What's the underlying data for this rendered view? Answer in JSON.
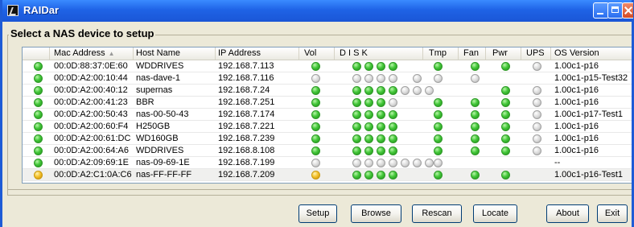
{
  "window": {
    "title": "RAIDar"
  },
  "group_title": "Select a NAS device to setup",
  "columns": [
    "Mac Address",
    "Host Name",
    "IP Address",
    "Vol",
    "D  I  S  K",
    "Tmp",
    "Fan",
    "Pwr",
    "UPS",
    "OS Version"
  ],
  "sort_indicator": "▲",
  "status_colors": {
    "green": "#44c83a",
    "gray": "#c8c8c8",
    "yellow": "#f5c330"
  },
  "rows": [
    {
      "status": "green",
      "mac": "00:0D:88:37:0E:60",
      "host": "WDDRIVES",
      "ip": "192.168.7.113",
      "vol": "green",
      "disks": [
        "green",
        "green",
        "green",
        "green"
      ],
      "tmp": "green",
      "fan": "green",
      "pwr": "green",
      "ups": "gray",
      "os": "1.00c1-p16"
    },
    {
      "status": "green",
      "mac": "00:0D:A2:00:10:44",
      "host": "nas-dave-1",
      "ip": "192.168.7.116",
      "vol": "gray",
      "disks": [
        "gray",
        "gray",
        "gray",
        "gray",
        "",
        "gray"
      ],
      "tmp": "gray",
      "fan": "gray",
      "pwr": "",
      "ups": "",
      "os": "1.00c1-p15-Test32"
    },
    {
      "status": "green",
      "mac": "00:0D:A2:00:40:12",
      "host": "supernas",
      "ip": "192.168.7.24",
      "vol": "green",
      "disks": [
        "green",
        "green",
        "green",
        "green",
        "gray",
        "gray",
        "gray"
      ],
      "tmp": "",
      "fan": "",
      "pwr": "green",
      "ups": "gray",
      "os": "1.00c1-p16"
    },
    {
      "status": "green",
      "mac": "00:0D:A2:00:41:23",
      "host": "BBR",
      "ip": "192.168.7.251",
      "vol": "green",
      "disks": [
        "green",
        "green",
        "green",
        "gray"
      ],
      "tmp": "green",
      "fan": "green",
      "pwr": "green",
      "ups": "gray",
      "os": "1.00c1-p16"
    },
    {
      "status": "green",
      "mac": "00:0D:A2:00:50:43",
      "host": "nas-00-50-43",
      "ip": "192.168.7.174",
      "vol": "green",
      "disks": [
        "green",
        "green",
        "green",
        "green"
      ],
      "tmp": "green",
      "fan": "green",
      "pwr": "green",
      "ups": "gray",
      "os": "1.00c1-p17-Test1"
    },
    {
      "status": "green",
      "mac": "00:0D:A2:00:60:F4",
      "host": "H250GB",
      "ip": "192.168.7.221",
      "vol": "green",
      "disks": [
        "green",
        "green",
        "green",
        "green"
      ],
      "tmp": "green",
      "fan": "green",
      "pwr": "green",
      "ups": "gray",
      "os": "1.00c1-p16"
    },
    {
      "status": "green",
      "mac": "00:0D:A2:00:61:DC",
      "host": "WD160GB",
      "ip": "192.168.7.239",
      "vol": "green",
      "disks": [
        "green",
        "green",
        "green",
        "green"
      ],
      "tmp": "green",
      "fan": "green",
      "pwr": "green",
      "ups": "gray",
      "os": "1.00c1-p16"
    },
    {
      "status": "green",
      "mac": "00:0D:A2:00:64:A6",
      "host": "WDDRIVES",
      "ip": "192.168.8.108",
      "vol": "green",
      "disks": [
        "green",
        "green",
        "green",
        "green"
      ],
      "tmp": "green",
      "fan": "green",
      "pwr": "green",
      "ups": "gray",
      "os": "1.00c1-p16"
    },
    {
      "status": "green",
      "mac": "00:0D:A2:09:69:1E",
      "host": "nas-09-69-1E",
      "ip": "192.168.7.199",
      "vol": "gray",
      "disks": [
        "gray",
        "gray",
        "gray",
        "gray",
        "gray",
        "gray",
        "gray"
      ],
      "tmp": "gray",
      "fan": "",
      "pwr": "",
      "ups": "",
      "os": "--"
    },
    {
      "status": "yellow",
      "mac": "00:0D:A2:C1:0A:C6",
      "host": "nas-FF-FF-FF",
      "ip": "192.168.7.209",
      "vol": "yellow",
      "disks": [
        "green",
        "green",
        "green",
        "green"
      ],
      "tmp": "green",
      "fan": "green",
      "pwr": "green",
      "ups": "",
      "os": "1.00c1-p16-Test1"
    }
  ],
  "buttons": {
    "setup": "Setup",
    "browse": "Browse",
    "rescan": "Rescan",
    "locate": "Locate",
    "about": "About",
    "exit": "Exit"
  }
}
